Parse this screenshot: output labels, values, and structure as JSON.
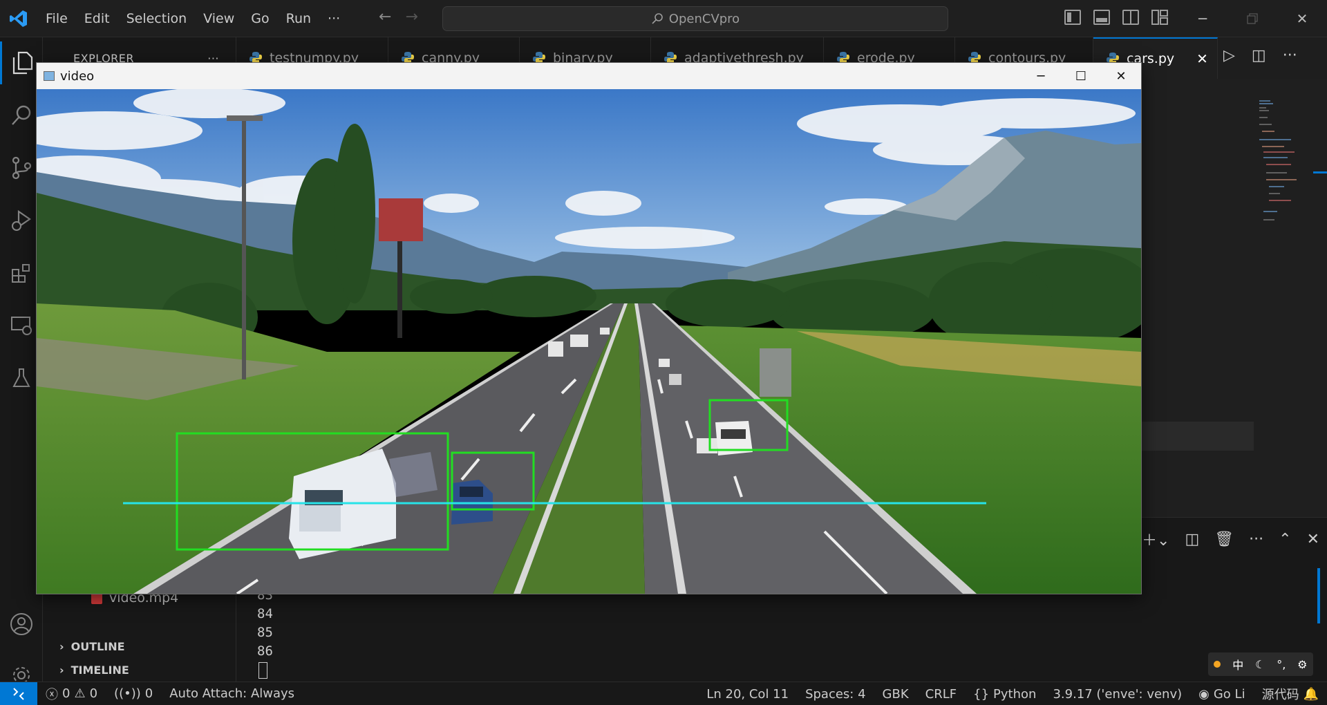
{
  "titlebar": {
    "menu": [
      "File",
      "Edit",
      "Selection",
      "View",
      "Go",
      "Run",
      "···"
    ],
    "search": "OpenCVpro"
  },
  "sidebar": {
    "header": "EXPLORER",
    "more": "···",
    "file": "video.mp4",
    "outline": "OUTLINE",
    "timeline": "TIMELINE"
  },
  "tabs": [
    {
      "label": "testnumpy.py"
    },
    {
      "label": "canny.py"
    },
    {
      "label": "binary.py"
    },
    {
      "label": "adaptivethresh.py"
    },
    {
      "label": "erode.py"
    },
    {
      "label": "contours.py"
    },
    {
      "label": "cars.py",
      "active": true
    }
  ],
  "panel": {
    "line_numbers": [
      "83",
      "84",
      "85",
      "86"
    ],
    "ime": [
      "中",
      "☾",
      "°,",
      "⚙"
    ]
  },
  "statusbar": {
    "errors": "0",
    "warnings": "0",
    "ports": "0",
    "auto_attach": "Auto Attach: Always",
    "position": "Ln 20, Col 11",
    "spaces": "Spaces: 4",
    "encoding": "GBK",
    "eol": "CRLF",
    "language": "Python",
    "interpreter": "3.9.17 ('enve': venv)",
    "golive": "Go Li",
    "extra": "源代码"
  },
  "video_window": {
    "title": "video",
    "detections_count_drawn": 3
  },
  "colors": {
    "accent": "#0078d4",
    "detection_box": "#22dd22",
    "count_line": "#27e3e8"
  }
}
